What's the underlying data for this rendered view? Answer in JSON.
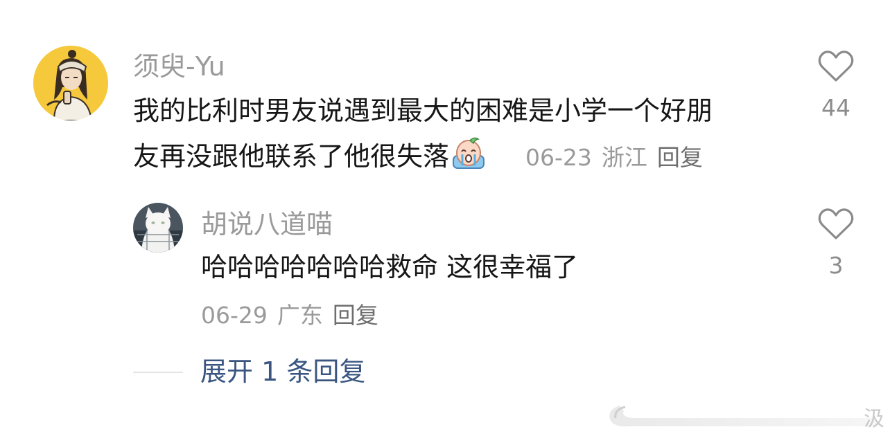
{
  "comment": {
    "username": "须臾-Yu",
    "text_line1": "我的比利时男友说遇到最大的困难是小学一个好朋",
    "text_line2": "友再没跟他联系了他很失落",
    "emoji": "crying-face-emoji",
    "date": "06-23",
    "location": "浙江",
    "reply_label": "回复",
    "like_icon": "heart-outline-icon",
    "like_count": "44"
  },
  "reply": {
    "username": "胡说八道喵",
    "text": "哈哈哈哈哈哈哈救命 这很幸福了",
    "date": "06-29",
    "location": "广东",
    "reply_label": "回复",
    "like_icon": "heart-outline-icon",
    "like_count": "3"
  },
  "expand_replies": "展开 1 条回复",
  "watermark": {
    "text": "汲"
  }
}
